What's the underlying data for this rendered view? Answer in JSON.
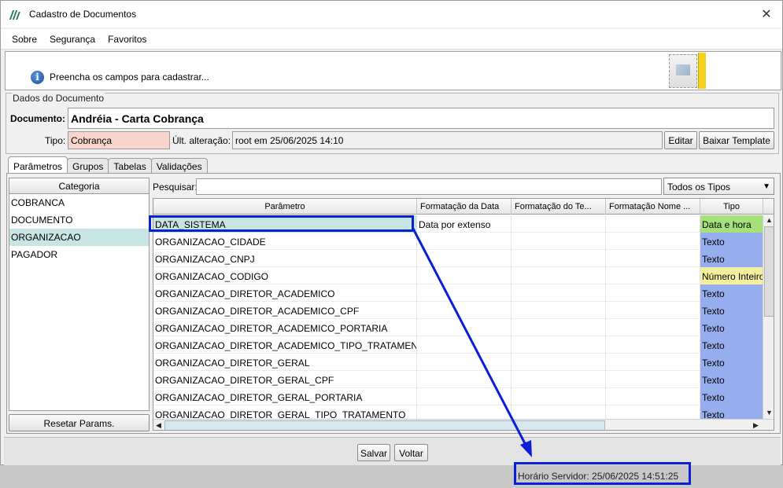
{
  "window": {
    "title": "Cadastro de Documentos"
  },
  "menu": [
    "Sobre",
    "Segurança",
    "Favoritos"
  ],
  "message": "Preencha os campos para cadastrar...",
  "dados": {
    "legend": "Dados do Documento",
    "documento_label": "Documento:",
    "documento_value": "Andréia - Carta Cobrança",
    "tipo_label": "Tipo:",
    "tipo_value": "Cobrança",
    "ult_label": "Últ. alteração:",
    "ult_value": "root em 25/06/2025 14:10",
    "editar": "Editar",
    "baixar": "Baixar Template"
  },
  "tabs": [
    "Parâmetros",
    "Grupos",
    "Tabelas",
    "Validações"
  ],
  "categoria": {
    "header": "Categoria",
    "items": [
      "COBRANCA",
      "DOCUMENTO",
      "ORGANIZACAO",
      "PAGADOR"
    ],
    "selected": "ORGANIZACAO",
    "reset_button": "Resetar Params."
  },
  "pesquisar_label": "Pesquisar:",
  "filter_select": "Todos os Tipos",
  "grid": {
    "columns": [
      "Parâmetro",
      "Formatação da Data",
      "Formatação do Te...",
      "Formatação Nome ...",
      "Tipo"
    ],
    "rows": [
      [
        "DATA_SISTEMA",
        "Data por extenso",
        "",
        "",
        "Data e hora"
      ],
      [
        "ORGANIZACAO_CIDADE",
        "",
        "",
        "",
        "Texto"
      ],
      [
        "ORGANIZACAO_CNPJ",
        "",
        "",
        "",
        "Texto"
      ],
      [
        "ORGANIZACAO_CODIGO",
        "",
        "",
        "",
        "Número Inteiro"
      ],
      [
        "ORGANIZACAO_DIRETOR_ACADEMICO",
        "",
        "",
        "",
        "Texto"
      ],
      [
        "ORGANIZACAO_DIRETOR_ACADEMICO_CPF",
        "",
        "",
        "",
        "Texto"
      ],
      [
        "ORGANIZACAO_DIRETOR_ACADEMICO_PORTARIA",
        "",
        "",
        "",
        "Texto"
      ],
      [
        "ORGANIZACAO_DIRETOR_ACADEMICO_TIPO_TRATAMENTO",
        "",
        "",
        "",
        "Texto"
      ],
      [
        "ORGANIZACAO_DIRETOR_GERAL",
        "",
        "",
        "",
        "Texto"
      ],
      [
        "ORGANIZACAO_DIRETOR_GERAL_CPF",
        "",
        "",
        "",
        "Texto"
      ],
      [
        "ORGANIZACAO_DIRETOR_GERAL_PORTARIA",
        "",
        "",
        "",
        "Texto"
      ],
      [
        "ORGANIZACAO_DIRETOR_GERAL_TIPO_TRATAMENTO",
        "",
        "",
        "",
        "Texto"
      ]
    ]
  },
  "tipo_colors": {
    "Data e hora": "#a6e07a",
    "Texto": "#96aeee",
    "Número Inteiro": "#f5f0a0"
  },
  "buttons": {
    "salvar": "Salvar",
    "voltar": "Voltar"
  },
  "server_time": "Horário Servidor: 25/06/2025 14:51:25",
  "annotation_color": "#0a1fd6"
}
